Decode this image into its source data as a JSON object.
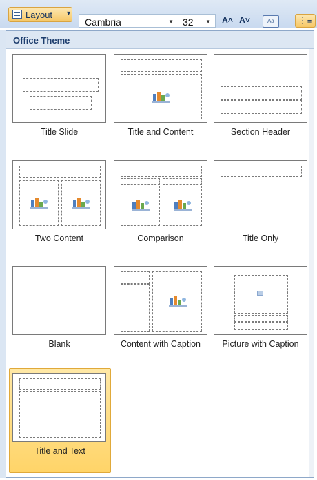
{
  "ribbon": {
    "layout_button_label": "Layout",
    "font_name": "Cambria",
    "font_size": "32",
    "grow_font_label": "A˄",
    "shrink_font_label": "A˅",
    "clear_format_label": "Aa"
  },
  "gallery": {
    "section_header": "Office Theme",
    "layouts": [
      {
        "label": "Title Slide"
      },
      {
        "label": "Title and Content"
      },
      {
        "label": "Section Header"
      },
      {
        "label": "Two Content"
      },
      {
        "label": "Comparison"
      },
      {
        "label": "Title Only"
      },
      {
        "label": "Blank"
      },
      {
        "label": "Content with Caption"
      },
      {
        "label": "Picture with Caption"
      },
      {
        "label": "Title and Text",
        "selected": true
      }
    ]
  },
  "colors": {
    "selection": "#ffd468",
    "header_text": "#1e3e6e"
  }
}
